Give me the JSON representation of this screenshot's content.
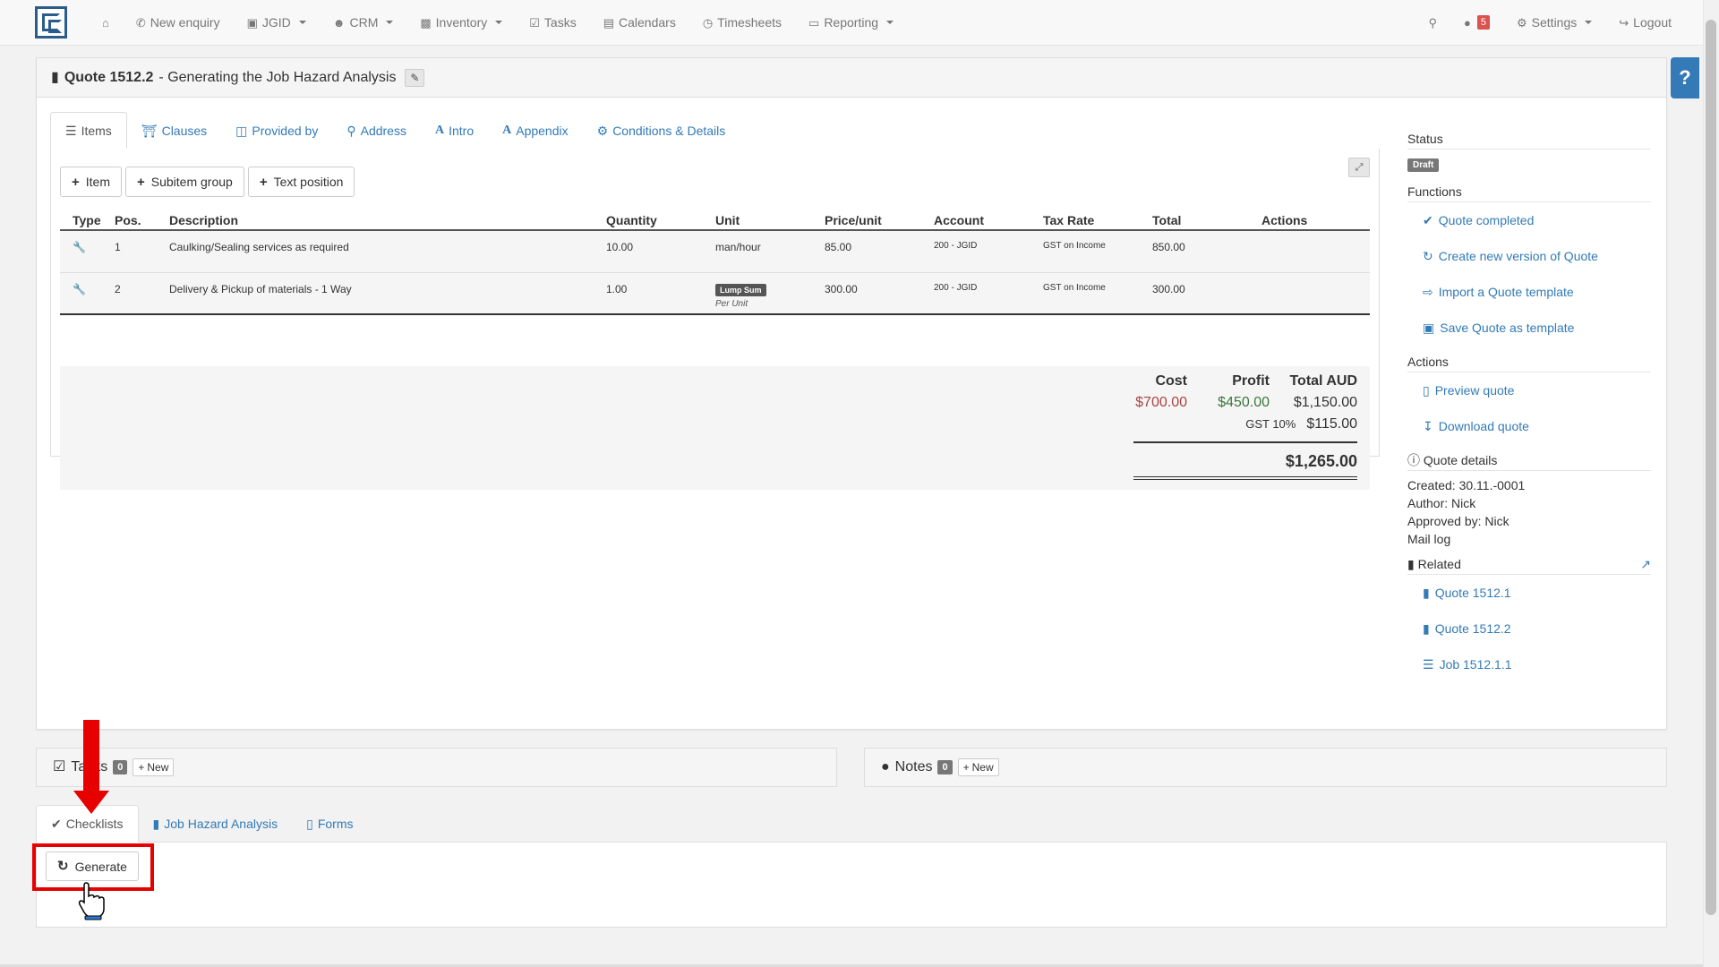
{
  "nav": {
    "new_enquiry": "New enquiry",
    "jgid": "JGID",
    "crm": "CRM",
    "inventory": "Inventory",
    "tasks": "Tasks",
    "calendars": "Calendars",
    "timesheets": "Timesheets",
    "reporting": "Reporting",
    "notifications_count": "5",
    "settings": "Settings",
    "logout": "Logout"
  },
  "help": {
    "label": "?"
  },
  "quote": {
    "number": "Quote 1512.2",
    "title_suffix": " - Generating the Job Hazard Analysis"
  },
  "tabs": [
    {
      "label": "Items"
    },
    {
      "label": "Clauses"
    },
    {
      "label": "Provided by"
    },
    {
      "label": "Address"
    },
    {
      "label": "Intro"
    },
    {
      "label": "Appendix"
    },
    {
      "label": "Conditions & Details"
    }
  ],
  "toolbar": {
    "item": "Item",
    "subitem_group": "Subitem group",
    "text_position": "Text position"
  },
  "table": {
    "headers": {
      "type": "Type",
      "pos": "Pos.",
      "description": "Description",
      "quantity": "Quantity",
      "unit": "Unit",
      "price": "Price/unit",
      "account": "Account",
      "tax": "Tax Rate",
      "total": "Total",
      "actions": "Actions"
    },
    "rows": [
      {
        "pos": "1",
        "description": "Caulking/Sealing services as required",
        "quantity": "10.00",
        "unit": "man/hour",
        "price": "85.00",
        "account": "200 - JGID",
        "tax": "GST on Income",
        "total": "850.00"
      },
      {
        "pos": "2",
        "description": "Delivery & Pickup of materials - 1 Way",
        "quantity": "1.00",
        "unit_badge": "Lump Sum",
        "unit_sub": "Per Unit",
        "price": "300.00",
        "account": "200 - JGID",
        "tax": "GST on Income",
        "total": "300.00"
      }
    ]
  },
  "totals": {
    "cost_label": "Cost",
    "profit_label": "Profit",
    "total_label": "Total AUD",
    "cost": "$700.00",
    "profit": "$450.00",
    "total": "$1,150.00",
    "gst_label": "GST 10%",
    "gst": "$115.00",
    "grand_total": "$1,265.00"
  },
  "sidebar": {
    "status_head": "Status",
    "status": "Draft",
    "functions_head": "Functions",
    "functions": [
      "Quote completed",
      "Create new version of Quote",
      "Import a Quote template",
      "Save Quote as template"
    ],
    "actions_head": "Actions",
    "actions": [
      "Preview quote",
      "Download quote"
    ],
    "details_head": "Quote details",
    "created": "Created: 30.11.-0001",
    "author": "Author: Nick",
    "approved": "Approved by: Nick",
    "mail_log": "Mail log",
    "related_head": "Related",
    "related": [
      "Quote 1512.1",
      "Quote 1512.2",
      "Job 1512.1.1"
    ]
  },
  "tasks_panel": {
    "title": "Tasks",
    "count": "0",
    "new": "New"
  },
  "notes_panel": {
    "title": "Notes",
    "count": "0",
    "new": "New"
  },
  "lower_tabs": [
    {
      "label": "Checklists"
    },
    {
      "label": "Job Hazard Analysis"
    },
    {
      "label": "Forms"
    }
  ],
  "generate": {
    "label": "Generate"
  },
  "colors": {
    "link": "#337ab7",
    "annotation": "#e60000",
    "cost": "#a94442",
    "profit": "#3c763d"
  }
}
